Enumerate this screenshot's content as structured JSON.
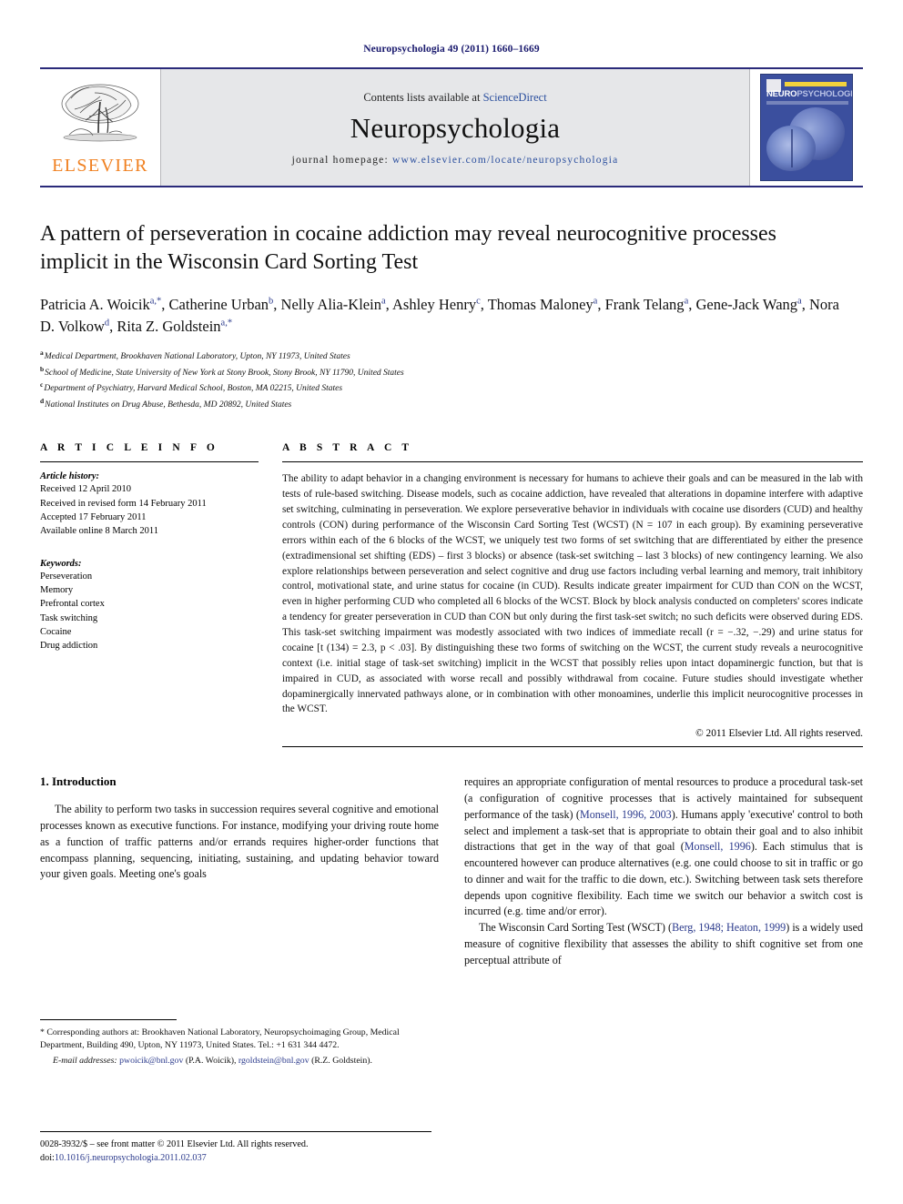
{
  "running_head": "Neuropsychologia 49 (2011) 1660–1669",
  "masthead": {
    "publisher_name": "ELSEVIER",
    "contents_prefix": "Contents lists available at ",
    "contents_link": "ScienceDirect",
    "journal_name": "Neuropsychologia",
    "homepage_prefix": "journal  homepage:  ",
    "homepage_url": "www.elsevier.com/locate/neuropsychologia",
    "cover": {
      "title_bold": "NEURO",
      "title_light": "PSYCHOLOGIA"
    }
  },
  "article": {
    "title": "A pattern of perseveration in cocaine addiction may reveal neurocognitive processes implicit in the Wisconsin Card Sorting Test",
    "authors_line1": "Patricia A. Woicik",
    "authors_html": "Patricia A. Woicik a,*, Catherine Urban b, Nelly Alia-Klein a, Ashley Henry c, Thomas Maloney a, Frank Telang a, Gene-Jack Wang a, Nora D. Volkow d, Rita Z. Goldstein a,*",
    "authors": [
      {
        "name": "Patricia A. Woicik",
        "sup": "a,*"
      },
      {
        "name": "Catherine Urban",
        "sup": "b"
      },
      {
        "name": "Nelly Alia-Klein",
        "sup": "a"
      },
      {
        "name": "Ashley Henry",
        "sup": "c"
      },
      {
        "name": "Thomas Maloney",
        "sup": "a"
      },
      {
        "name": "Frank Telang",
        "sup": "a"
      },
      {
        "name": "Gene-Jack Wang",
        "sup": "a"
      },
      {
        "name": "Nora D. Volkow",
        "sup": "d"
      },
      {
        "name": "Rita Z. Goldstein",
        "sup": "a,*"
      }
    ],
    "affiliations": [
      {
        "sup": "a",
        "text": "Medical Department, Brookhaven National Laboratory, Upton, NY 11973, United States"
      },
      {
        "sup": "b",
        "text": "School of Medicine, State University of New York at Stony Brook, Stony Brook, NY 11790, United States"
      },
      {
        "sup": "c",
        "text": "Department of Psychiatry, Harvard Medical School, Boston, MA 02215, United States"
      },
      {
        "sup": "d",
        "text": "National Institutes on Drug Abuse, Bethesda, MD 20892, United States"
      }
    ]
  },
  "article_info": {
    "heading": "A R T I C L E   I N F O",
    "history_label": "Article history:",
    "history": [
      "Received 12 April 2010",
      "Received in revised form 14 February 2011",
      "Accepted 17 February 2011",
      "Available online 8 March 2011"
    ],
    "keywords_label": "Keywords:",
    "keywords": [
      "Perseveration",
      "Memory",
      "Prefrontal cortex",
      "Task switching",
      "Cocaine",
      "Drug addiction"
    ]
  },
  "abstract": {
    "heading": "A B S T R A C T",
    "text": "The ability to adapt behavior in a changing environment is necessary for humans to achieve their goals and can be measured in the lab with tests of rule-based switching. Disease models, such as cocaine addiction, have revealed that alterations in dopamine interfere with adaptive set switching, culminating in perseveration. We explore perseverative behavior in individuals with cocaine use disorders (CUD) and healthy controls (CON) during performance of the Wisconsin Card Sorting Test (WCST) (N = 107 in each group). By examining perseverative errors within each of the 6 blocks of the WCST, we uniquely test two forms of set switching that are differentiated by either the presence (extradimensional set shifting (EDS) – first 3 blocks) or absence (task-set switching – last 3 blocks) of new contingency learning. We also explore relationships between perseveration and select cognitive and drug use factors including verbal learning and memory, trait inhibitory control, motivational state, and urine status for cocaine (in CUD). Results indicate greater impairment for CUD than CON on the WCST, even in higher performing CUD who completed all 6 blocks of the WCST. Block by block analysis conducted on completers' scores indicate a tendency for greater perseveration in CUD than CON but only during the first task-set switch; no such deficits were observed during EDS. This task-set switching impairment was modestly associated with two indices of immediate recall (r = −.32, −.29) and urine status for cocaine [t (134) = 2.3, p < .03]. By distinguishing these two forms of switching on the WCST, the current study reveals a neurocognitive context (i.e. initial stage of task-set switching) implicit in the WCST that possibly relies upon intact dopaminergic function, but that is impaired in CUD, as associated with worse recall and possibly withdrawal from cocaine. Future studies should investigate whether dopaminergically innervated pathways alone, or in combination with other monoamines, underlie this implicit neurocognitive processes in the WCST.",
    "copyright": "© 2011 Elsevier Ltd. All rights reserved."
  },
  "body": {
    "section_number_title": "1.  Introduction",
    "left_para_1": "The ability to perform two tasks in succession requires several cognitive and emotional processes known as executive functions. For instance, modifying your driving route home as a function of traffic patterns and/or errands requires higher-order functions that encompass planning, sequencing, initiating, sustaining, and updating behavior toward your given goals. Meeting one's goals",
    "right_para_1_a": "requires an appropriate configuration of mental resources to produce a procedural task-set (a configuration of cognitive processes that is actively maintained for subsequent performance of the task) (",
    "right_cite_1": "Monsell, 1996, 2003",
    "right_para_1_b": "). Humans apply 'executive' control to both select and implement a task-set that is appropriate to obtain their goal and to also inhibit distractions that get in the way of that goal (",
    "right_cite_2": "Monsell, 1996",
    "right_para_1_c": "). Each stimulus that is encountered however can produce alternatives (e.g. one could choose to sit in traffic or go to dinner and wait for the traffic to die down, etc.). Switching between task sets therefore depends upon cognitive flexibility. Each time we switch our behavior a switch cost is incurred (e.g. time and/or error).",
    "right_para_2_a": "The Wisconsin Card Sorting Test (WSCT) (",
    "right_cite_3": "Berg, 1948; Heaton, 1999",
    "right_para_2_b": ") is a widely used measure of cognitive flexibility that assesses the ability to shift cognitive set from one perceptual attribute of"
  },
  "footnote": {
    "corr_marker": "*",
    "corr_text": "Corresponding authors at: Brookhaven National Laboratory, Neuropsychoimaging Group, Medical Department, Building 490, Upton, NY 11973, United States. Tel.: +1 631 344 4472.",
    "email_label": "E-mail addresses:",
    "email_1": "pwoicik@bnl.gov",
    "email_1_owner": "(P.A. Woicik),",
    "email_2": "rgoldstein@bnl.gov",
    "email_2_owner": "(R.Z. Goldstein)."
  },
  "issn": {
    "line_1": "0028-3932/$ – see front matter © 2011 Elsevier Ltd. All rights reserved.",
    "doi_label": "doi:",
    "doi_value": "10.1016/j.neuropsychologia.2011.02.037"
  },
  "colors": {
    "header_blue": "#1a1a6e",
    "link_blue": "#2b4f9e",
    "cite_blue": "#2b3a8c",
    "elsevier_orange": "#f08020",
    "masthead_gray": "#e6e7e9",
    "cover_blue": "#3b4f9e"
  }
}
